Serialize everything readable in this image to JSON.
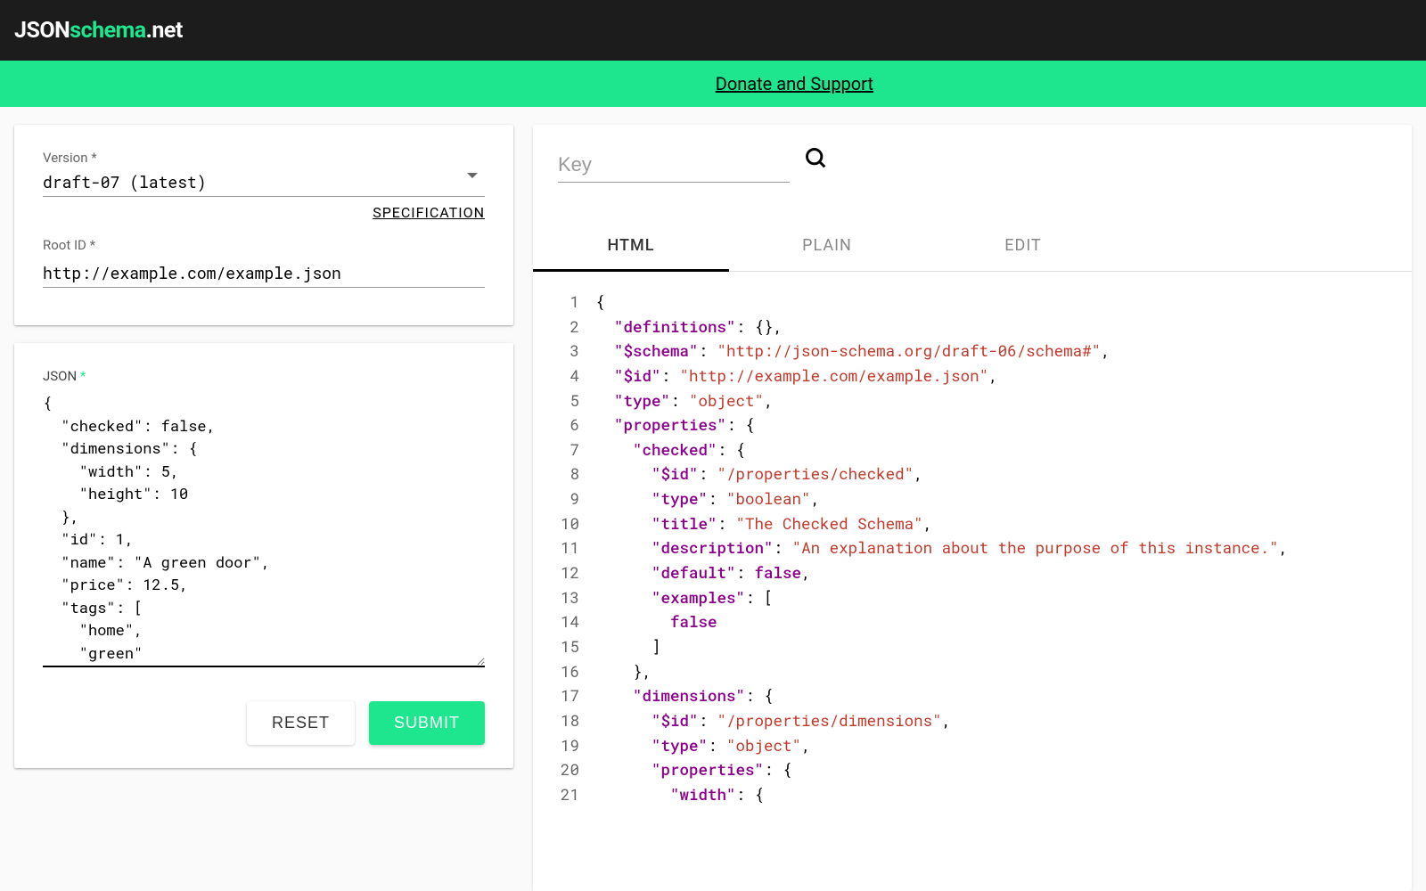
{
  "logo": {
    "p1": "JSON",
    "p2": "schema",
    "p3": ".net"
  },
  "donate": "Donate and Support",
  "config": {
    "version_label": "Version *",
    "version_value": "draft-07 (latest)",
    "spec_link": "SPECIFICATION",
    "root_label": "Root ID *",
    "root_value": "http://example.com/example.json"
  },
  "json_panel": {
    "label": "JSON",
    "star": " *",
    "text": "{\n  \"checked\": false,\n  \"dimensions\": {\n    \"width\": 5,\n    \"height\": 10\n  },\n  \"id\": 1,\n  \"name\": \"A green door\",\n  \"price\": 12.5,\n  \"tags\": [\n    \"home\",\n    \"green\"\n  ]\n}|",
    "reset": "RESET",
    "submit": "SUBMIT"
  },
  "search_placeholder": "Key",
  "tabs": {
    "html": "HTML",
    "plain": "PLAIN",
    "edit": "EDIT"
  },
  "code": [
    [
      [
        "punc",
        "{"
      ]
    ],
    [
      [
        "punc",
        "  "
      ],
      [
        "key",
        "\"definitions\""
      ],
      [
        "punc",
        ": {},"
      ]
    ],
    [
      [
        "punc",
        "  "
      ],
      [
        "key",
        "\"$schema\""
      ],
      [
        "punc",
        ": "
      ],
      [
        "str",
        "\"http://json-schema.org/draft-06/schema#\""
      ],
      [
        "punc",
        ","
      ]
    ],
    [
      [
        "punc",
        "  "
      ],
      [
        "key",
        "\"$id\""
      ],
      [
        "punc",
        ": "
      ],
      [
        "str",
        "\"http://example.com/example.json\""
      ],
      [
        "punc",
        ","
      ]
    ],
    [
      [
        "punc",
        "  "
      ],
      [
        "key",
        "\"type\""
      ],
      [
        "punc",
        ": "
      ],
      [
        "str",
        "\"object\""
      ],
      [
        "punc",
        ","
      ]
    ],
    [
      [
        "punc",
        "  "
      ],
      [
        "key",
        "\"properties\""
      ],
      [
        "punc",
        ": {"
      ]
    ],
    [
      [
        "punc",
        "    "
      ],
      [
        "key",
        "\"checked\""
      ],
      [
        "punc",
        ": {"
      ]
    ],
    [
      [
        "punc",
        "      "
      ],
      [
        "key",
        "\"$id\""
      ],
      [
        "punc",
        ": "
      ],
      [
        "str",
        "\"/properties/checked\""
      ],
      [
        "punc",
        ","
      ]
    ],
    [
      [
        "punc",
        "      "
      ],
      [
        "key",
        "\"type\""
      ],
      [
        "punc",
        ": "
      ],
      [
        "str",
        "\"boolean\""
      ],
      [
        "punc",
        ","
      ]
    ],
    [
      [
        "punc",
        "      "
      ],
      [
        "key",
        "\"title\""
      ],
      [
        "punc",
        ": "
      ],
      [
        "str",
        "\"The Checked Schema\""
      ],
      [
        "punc",
        ","
      ]
    ],
    [
      [
        "punc",
        "      "
      ],
      [
        "key",
        "\"description\""
      ],
      [
        "punc",
        ": "
      ],
      [
        "str",
        "\"An explanation about the purpose of this instance.\""
      ],
      [
        "punc",
        ","
      ]
    ],
    [
      [
        "punc",
        "      "
      ],
      [
        "key",
        "\"default\""
      ],
      [
        "punc",
        ": "
      ],
      [
        "bool",
        "false"
      ],
      [
        "punc",
        ","
      ]
    ],
    [
      [
        "punc",
        "      "
      ],
      [
        "key",
        "\"examples\""
      ],
      [
        "punc",
        ": ["
      ]
    ],
    [
      [
        "punc",
        "        "
      ],
      [
        "bool",
        "false"
      ]
    ],
    [
      [
        "punc",
        "      ]"
      ]
    ],
    [
      [
        "punc",
        "    },"
      ]
    ],
    [
      [
        "punc",
        "    "
      ],
      [
        "key",
        "\"dimensions\""
      ],
      [
        "punc",
        ": {"
      ]
    ],
    [
      [
        "punc",
        "      "
      ],
      [
        "key",
        "\"$id\""
      ],
      [
        "punc",
        ": "
      ],
      [
        "str",
        "\"/properties/dimensions\""
      ],
      [
        "punc",
        ","
      ]
    ],
    [
      [
        "punc",
        "      "
      ],
      [
        "key",
        "\"type\""
      ],
      [
        "punc",
        ": "
      ],
      [
        "str",
        "\"object\""
      ],
      [
        "punc",
        ","
      ]
    ],
    [
      [
        "punc",
        "      "
      ],
      [
        "key",
        "\"properties\""
      ],
      [
        "punc",
        ": {"
      ]
    ],
    [
      [
        "punc",
        "        "
      ],
      [
        "key",
        "\"width\""
      ],
      [
        "punc",
        ": {"
      ]
    ]
  ]
}
